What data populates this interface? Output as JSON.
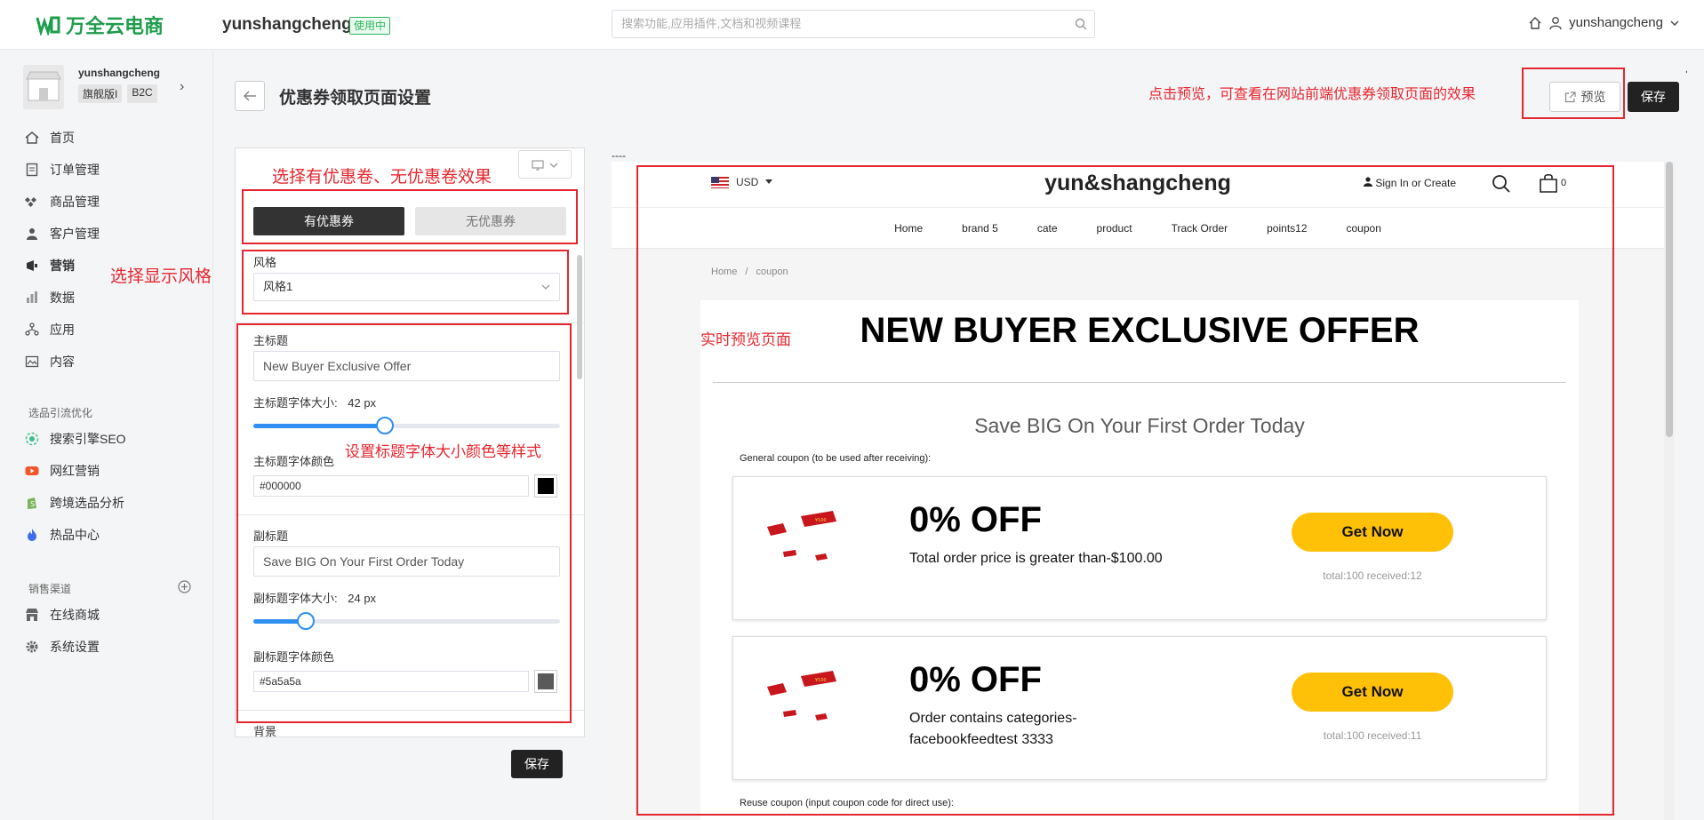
{
  "app": {
    "logo": "万全云电商",
    "store_name": "yunshangcheng",
    "status_badge": "使用中",
    "user": "yunshangcheng"
  },
  "search": {
    "placeholder": "搜索功能,应用插件,文档和视频课程"
  },
  "shop": {
    "name": "yunshangcheng",
    "badges": [
      "旗舰版I",
      "B2C"
    ]
  },
  "nav": {
    "items": [
      {
        "label": "首页",
        "icon": "home-icon"
      },
      {
        "label": "订单管理",
        "icon": "order-icon"
      },
      {
        "label": "商品管理",
        "icon": "product-icon"
      },
      {
        "label": "客户管理",
        "icon": "customer-icon"
      },
      {
        "label": "营销",
        "icon": "marketing-icon"
      },
      {
        "label": "数据",
        "icon": "data-icon"
      },
      {
        "label": "应用",
        "icon": "app-icon"
      },
      {
        "label": "内容",
        "icon": "content-icon"
      }
    ],
    "section1": "选品引流优化",
    "section1_items": [
      {
        "label": "搜索引擎SEO",
        "icon": "seo-icon",
        "color": "#3cc08a"
      },
      {
        "label": "网红营销",
        "icon": "youtube-icon",
        "color": "#f0552b"
      },
      {
        "label": "跨境选品分析",
        "icon": "shopify-icon",
        "color": "#7ab55c"
      },
      {
        "label": "热品中心",
        "icon": "fire-icon",
        "color": "#3f6ee8"
      }
    ],
    "section2": "销售渠道",
    "section2_items": [
      {
        "label": "在线商城",
        "icon": "store-icon"
      },
      {
        "label": "系统设置",
        "icon": "settings-icon"
      }
    ]
  },
  "page": {
    "title": "优惠券领取页面设置",
    "preview_btn": "预览",
    "save_btn": "保存"
  },
  "panel": {
    "tab_with": "有优惠券",
    "tab_without": "无优惠券",
    "style_label": "风格",
    "style_value": "风格1",
    "main_title_label": "主标题",
    "main_title_value": "New Buyer Exclusive Offer",
    "main_size_label": "主标题字体大小:",
    "main_size_value": "42 px",
    "main_size_fraction": 0.43,
    "main_color_label": "主标题字体颜色",
    "main_color_value": "#000000",
    "sub_title_label": "副标题",
    "sub_title_value": "Save BIG On Your First Order Today",
    "sub_size_label": "副标题字体大小:",
    "sub_size_value": "24 px",
    "sub_size_fraction": 0.17,
    "sub_color_label": "副标题字体颜色",
    "sub_color_value": "#5a5a5a",
    "bg_label": "背景",
    "save_btn": "保存"
  },
  "annotations": {
    "preview_hint": "点击预览，可查看在网站前端优惠券领取页面的效果",
    "coupon_state": "选择有优惠卷、无优惠卷效果",
    "style_hint": "选择显示风格",
    "font_hint": "设置标题字体大小颜色等样式",
    "live_preview": "实时预览页面"
  },
  "preview": {
    "dashes": "----",
    "currency": "USD",
    "brand": "yun&shangcheng",
    "sign_in": "Sign In or Create",
    "cart_count": "0",
    "links": [
      "Home",
      "brand 5",
      "cate",
      "product",
      "Track Order",
      "points12",
      "coupon"
    ],
    "breadcrumb_home": "Home",
    "breadcrumb_sep": "/",
    "breadcrumb_current": "coupon",
    "title": "NEW BUYER EXCLUSIVE OFFER",
    "subtitle": "Save BIG On Your First Order Today",
    "general_label": "General coupon (to be used after receiving):",
    "reuse_label": "Reuse coupon (input coupon code for direct use):",
    "coupons": [
      {
        "off": "0% OFF",
        "condition": "Total order price is greater than-$100.00",
        "button": "Get Now",
        "stats": "total:100 received:12"
      },
      {
        "off": "0% OFF",
        "condition": "Order contains categories-facebookfeedtest 3333",
        "button": "Get Now",
        "stats": "total:100 received:11"
      }
    ]
  }
}
